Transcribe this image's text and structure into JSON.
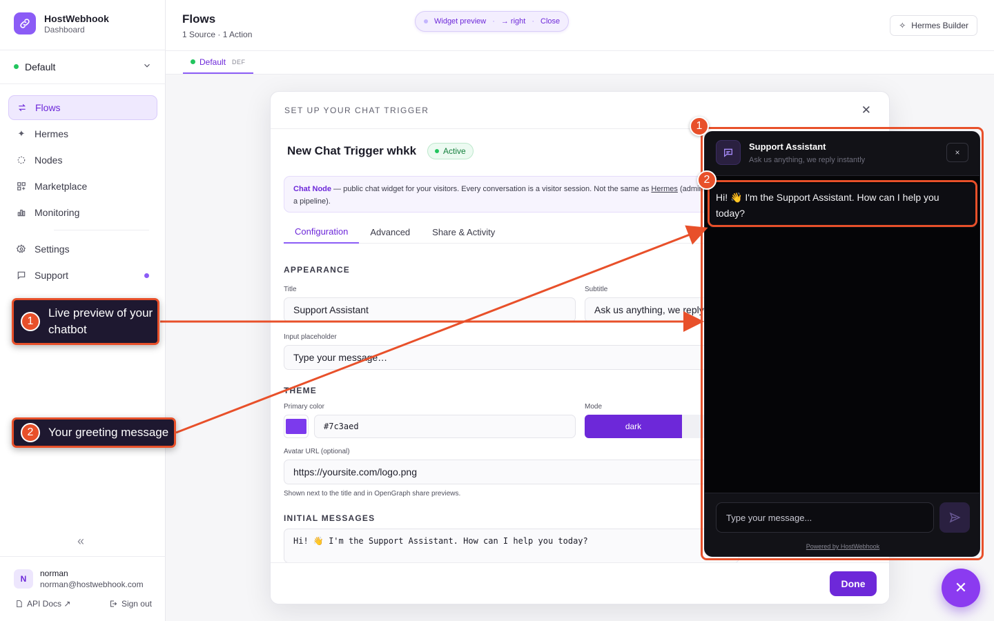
{
  "brand": {
    "name": "HostWebhook",
    "sub": "Dashboard"
  },
  "workspace": {
    "name": "Default"
  },
  "nav": [
    {
      "label": "Flows",
      "icon": "arrows-swap-icon"
    },
    {
      "label": "Hermes",
      "icon": "sparkles-icon"
    },
    {
      "label": "Nodes",
      "icon": "nodes-icon"
    },
    {
      "label": "Marketplace",
      "icon": "grid-plus-icon"
    },
    {
      "label": "Monitoring",
      "icon": "bar-chart-icon"
    },
    {
      "label": "Settings",
      "icon": "gear-icon"
    },
    {
      "label": "Support",
      "icon": "chat-icon"
    }
  ],
  "user": {
    "initial": "N",
    "name": "norman",
    "email": "norman@hostwebhook.com"
  },
  "footer": {
    "api_docs": "API Docs ↗",
    "sign_out": "Sign out"
  },
  "header": {
    "title": "Flows",
    "subtitle": "1 Source · 1 Action",
    "hermes_btn": "Hermes Builder"
  },
  "preview_pill": {
    "label": "Widget preview",
    "sep": "·",
    "position": "→ right",
    "close": "Close"
  },
  "subtab": {
    "label": "Default",
    "tag": "DEF"
  },
  "modal": {
    "title": "SET UP YOUR CHAT TRIGGER",
    "trigger_name": "New Chat Trigger whkk",
    "status": "Active",
    "info_strong": "Chat Node",
    "info_text": " — public chat widget for your visitors. Every conversation is a visitor session. Not the same as ",
    "info_link": "Hermes",
    "info_tail": " (admin",
    "info_line2": "a pipeline).",
    "tabs": [
      "Configuration",
      "Advanced",
      "Share & Activity"
    ],
    "appearance": "APPEARANCE",
    "title_label": "Title",
    "title_value": "Support Assistant",
    "subtitle_label": "Subtitle",
    "subtitle_value": "Ask us anything, we reply",
    "placeholder_label": "Input placeholder",
    "placeholder_value": "Type your message…",
    "theme": "THEME",
    "color_label": "Primary color",
    "color_value": "#7c3aed",
    "mode_label": "Mode",
    "mode_value": "dark",
    "avatar_label": "Avatar URL (optional)",
    "avatar_value": "https://yoursite.com/logo.png",
    "avatar_hint": "Shown next to the title and in OpenGraph share previews.",
    "initial_messages": "INITIAL MESSAGES",
    "initial_value": "Hi! 👋 I'm the Support Assistant. How can I help you today?",
    "done": "Done"
  },
  "widget": {
    "title": "Support Assistant",
    "subtitle": "Ask us anything, we reply instantly",
    "close": "×",
    "greeting": "Hi! 👋 I'm the Support Assistant. How can I help you today?",
    "input_placeholder": "Type your message...",
    "powered": "Powered by HostWebhook"
  },
  "callouts": [
    {
      "num": "1",
      "text": "Live preview of your chatbot"
    },
    {
      "num": "2",
      "text": "Your greeting message"
    }
  ],
  "colors": {
    "accent": "#6d28d9",
    "annotation": "#e8502a",
    "brand": "#8b5cf6"
  }
}
